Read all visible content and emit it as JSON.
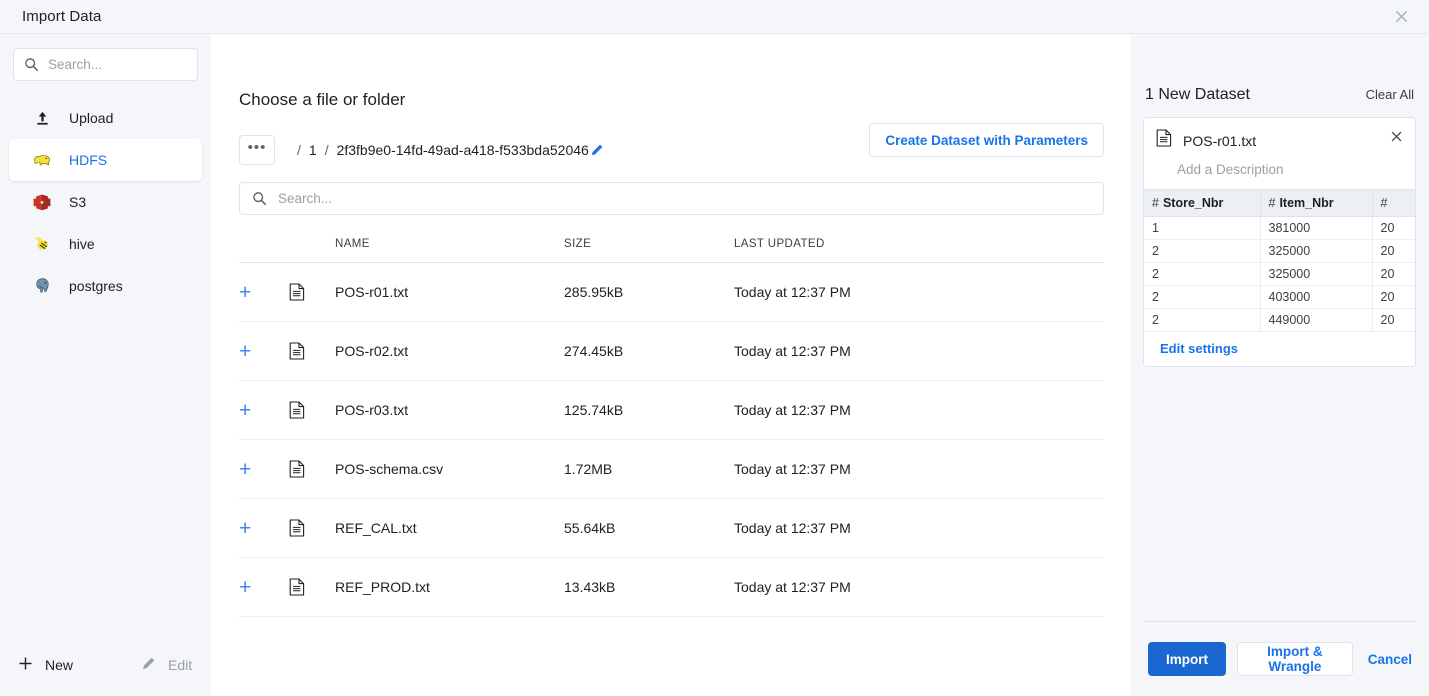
{
  "window": {
    "title": "Import Data",
    "close_icon": "close-icon"
  },
  "sidebar": {
    "search": {
      "placeholder": "Search...",
      "value": "",
      "icon": "search-icon"
    },
    "items": [
      {
        "label": "Upload",
        "icon": "upload-icon",
        "selected": false
      },
      {
        "label": "HDFS",
        "icon": "hadoop-elephant-icon",
        "selected": true
      },
      {
        "label": "S3",
        "icon": "aws-s3-icon",
        "selected": false
      },
      {
        "label": "hive",
        "icon": "hive-bee-icon",
        "selected": false
      },
      {
        "label": "postgres",
        "icon": "postgres-elephant-icon",
        "selected": false
      }
    ],
    "footer": {
      "new_label": "New",
      "new_icon": "plus-icon",
      "edit_label": "Edit",
      "edit_icon": "pencil-icon"
    }
  },
  "main": {
    "title": "Choose a file or folder",
    "breadcrumb": {
      "overflow_label": "•••",
      "separator": "/",
      "items": [
        "1",
        "2f3fb9e0-14fd-49ad-a418-f533bda52046"
      ],
      "edit_icon": "pencil-icon"
    },
    "create_dataset_button": "Create Dataset with Parameters",
    "search": {
      "placeholder": "Search...",
      "value": "",
      "icon": "search-icon"
    },
    "table": {
      "columns": [
        "NAME",
        "SIZE",
        "LAST UPDATED"
      ],
      "rows": [
        {
          "add_icon": "plus-icon",
          "file_icon": "file-icon",
          "name": "POS-r01.txt",
          "size": "285.95kB",
          "updated": "Today at 12:37 PM"
        },
        {
          "add_icon": "plus-icon",
          "file_icon": "file-icon",
          "name": "POS-r02.txt",
          "size": "274.45kB",
          "updated": "Today at 12:37 PM"
        },
        {
          "add_icon": "plus-icon",
          "file_icon": "file-icon",
          "name": "POS-r03.txt",
          "size": "125.74kB",
          "updated": "Today at 12:37 PM"
        },
        {
          "add_icon": "plus-icon",
          "file_icon": "file-icon",
          "name": "POS-schema.csv",
          "size": "1.72MB",
          "updated": "Today at 12:37 PM"
        },
        {
          "add_icon": "plus-icon",
          "file_icon": "file-icon",
          "name": "REF_CAL.txt",
          "size": "55.64kB",
          "updated": "Today at 12:37 PM"
        },
        {
          "add_icon": "plus-icon",
          "file_icon": "file-icon",
          "name": "REF_PROD.txt",
          "size": "13.43kB",
          "updated": "Today at 12:37 PM"
        }
      ]
    }
  },
  "right_panel": {
    "title": "1 New Dataset",
    "clear_all": "Clear All",
    "dataset": {
      "file_icon": "file-icon",
      "name": "POS-r01.txt",
      "close_icon": "close-icon",
      "description_placeholder": "Add a Description",
      "edit_settings": "Edit settings",
      "preview": {
        "type_glyph": "#",
        "columns": [
          "Store_Nbr",
          "Item_Nbr",
          ""
        ],
        "rows": [
          [
            "1",
            "381000",
            "20"
          ],
          [
            "2",
            "325000",
            "20"
          ],
          [
            "2",
            "325000",
            "20"
          ],
          [
            "2",
            "403000",
            "20"
          ],
          [
            "2",
            "449000",
            "20"
          ]
        ]
      }
    },
    "actions": {
      "import": "Import",
      "import_wrangle": "Import & Wrangle",
      "cancel": "Cancel"
    }
  },
  "colors": {
    "accent_blue": "#1a73e8",
    "primary_button": "#1a67d2",
    "panel_bg": "#f4f6fa",
    "border": "#dfe3eb"
  }
}
